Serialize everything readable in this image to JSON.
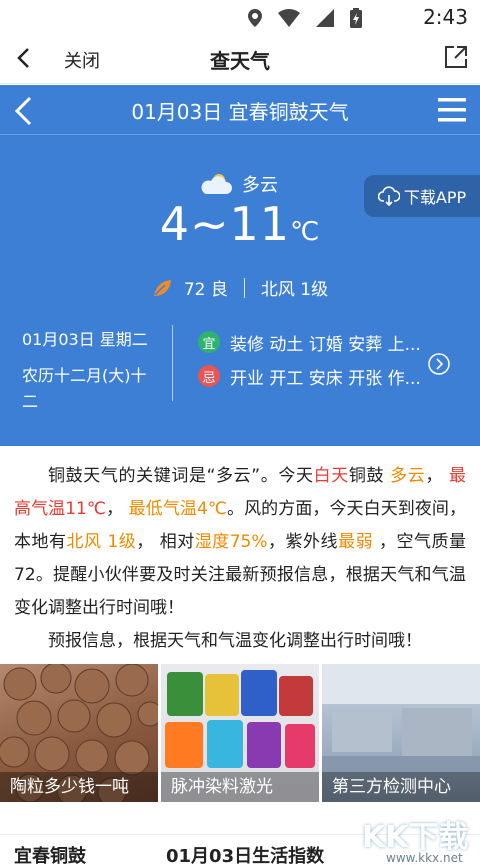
{
  "status_bar": {
    "time": "2:43"
  },
  "app_nav": {
    "close_label": "关闭",
    "title": "查天气"
  },
  "weather": {
    "header_title": "01月03日 宜春铜鼓天气",
    "condition": "多云",
    "temp_range": "4~11",
    "temp_unit": "℃",
    "download_label": "下载APP",
    "aqi_value": "72 良",
    "wind": "北风 1级",
    "date_line": "01月03日 星期二",
    "lunar_line": "农历十二月(大)十二",
    "yi_badge": "宜",
    "yi_text": "装修 动土 订婚 安葬 上...",
    "ji_badge": "忌",
    "ji_text": "开业 开工 安床 开张 作..."
  },
  "article": {
    "p1": {
      "a": "铜鼓天气的关键词是“多云”。今天",
      "b": "白天",
      "c": "铜鼓 ",
      "d": "多云",
      "e": "， ",
      "f": "最高气温11℃",
      "g": "， ",
      "h": "最低气温4℃",
      "i": "。风的方面，今天白天到夜间，本地有",
      "j": "北风 1级",
      "k": "， 相对",
      "l": "湿度75%",
      "m": "，紫外线",
      "n": "最弱",
      "o": " ，空气质量72。提醒小伙伴要及时关注最新预报信息，根据天气和气温变化调整出行时间哦！"
    },
    "p2": "预报信息，根据天气和气温变化调整出行时间哦！"
  },
  "ads": [
    {
      "caption": "陶粒多少钱一吨"
    },
    {
      "caption": "脉冲染料激光"
    },
    {
      "caption": "第三方检测中心"
    }
  ],
  "bottom": {
    "tab_left": "宜春铜鼓",
    "tab_right": "01月03日生活指数",
    "watermark": "KK下载",
    "watermark_url": "www.kkx.net"
  },
  "colors": {
    "panel_blue": "#3e7fd6",
    "highlight_orange": "#f08a00",
    "highlight_red": "#e93b30",
    "yi_green": "#2db36b",
    "ji_red": "#e95454"
  }
}
